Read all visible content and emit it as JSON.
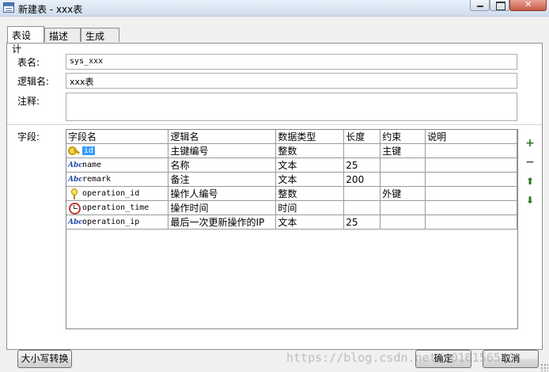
{
  "window": {
    "title": "新建表 - xxx表"
  },
  "tabs": [
    {
      "label": "表设计",
      "active": true
    },
    {
      "label": "描述",
      "active": false
    },
    {
      "label": "生成",
      "active": false
    }
  ],
  "form": {
    "table_name_label": "表名:",
    "table_name_value": "sys_xxx",
    "logical_name_label": "逻辑名:",
    "logical_name_value": "xxx表",
    "comment_label": "注释:",
    "comment_value": "",
    "fields_label": "字段:"
  },
  "grid": {
    "columns": [
      "字段名",
      "逻辑名",
      "数据类型",
      "长度",
      "约束",
      "说明"
    ],
    "rows": [
      {
        "icon": "primary-key-icon",
        "name": "id",
        "logical": "主键编号",
        "type": "整数",
        "length": "",
        "constraint": "主键",
        "note": "",
        "selected": true
      },
      {
        "icon": "text-field-icon",
        "name": "name",
        "logical": "名称",
        "type": "文本",
        "length": "25",
        "constraint": "",
        "note": ""
      },
      {
        "icon": "text-field-icon",
        "name": "remark",
        "logical": "备注",
        "type": "文本",
        "length": "200",
        "constraint": "",
        "note": ""
      },
      {
        "icon": "foreign-key-icon",
        "name": "operation_id",
        "logical": "操作人编号",
        "type": "整数",
        "length": "",
        "constraint": "外键",
        "note": ""
      },
      {
        "icon": "clock-icon",
        "name": "operation_time",
        "logical": "操作时间",
        "type": "时间",
        "length": "",
        "constraint": "",
        "note": ""
      },
      {
        "icon": "text-field-icon",
        "name": "operation_ip",
        "logical": "最后一次更新操作的IP",
        "type": "文本",
        "length": "25",
        "constraint": "",
        "note": ""
      }
    ]
  },
  "side_buttons": {
    "add": "+",
    "remove": "−",
    "up": "⬆",
    "down": "⬇"
  },
  "buttons": {
    "case_convert": "大小写转换",
    "ok": "确定",
    "cancel": "取消"
  },
  "watermark": "https://blog.csdn.net/u010156540"
}
